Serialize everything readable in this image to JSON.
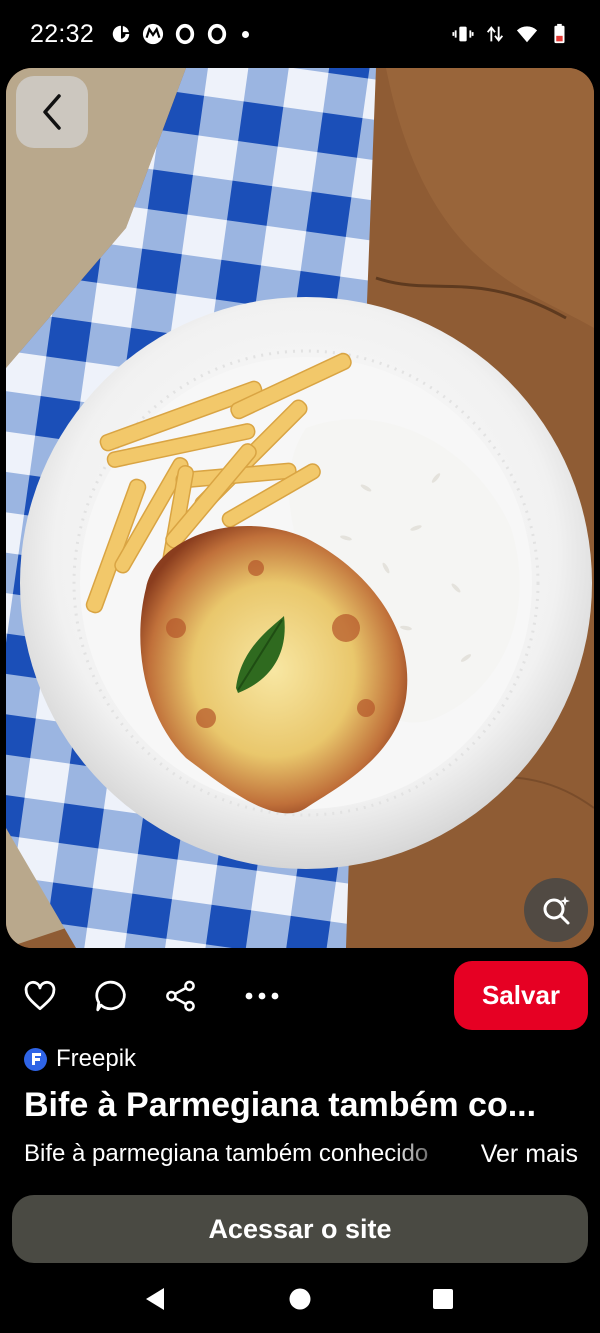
{
  "status_bar": {
    "time": "22:32",
    "left_icons": [
      "data-saver-icon",
      "motorola-icon",
      "notification-o-icon",
      "notification-o-icon",
      "dot-icon"
    ],
    "right_icons": [
      "vibrate-icon",
      "data-arrows-icon",
      "wifi-icon",
      "battery-low-icon"
    ]
  },
  "pin": {
    "image_alt": "Bife à Parmegiana com arroz e batata frita",
    "actions": {
      "like_icon": "heart-icon",
      "comment_icon": "comment-icon",
      "share_icon": "share-icon",
      "more_icon": "more-dots-icon",
      "save_label": "Salvar"
    },
    "source": {
      "logo_letter": "F",
      "name": "Freepik"
    },
    "title": "Bife à Parmegiana também co...",
    "description": "Bife à parmegiana também conhecido",
    "see_more_label": "Ver mais",
    "visit_label": "Acessar o site"
  },
  "colors": {
    "save_red": "#e60023",
    "visit_button": "#4a4a43",
    "source_blue": "#2f64e6"
  },
  "nav": {
    "icons": [
      "back-triangle-icon",
      "home-circle-icon",
      "recents-square-icon"
    ]
  }
}
